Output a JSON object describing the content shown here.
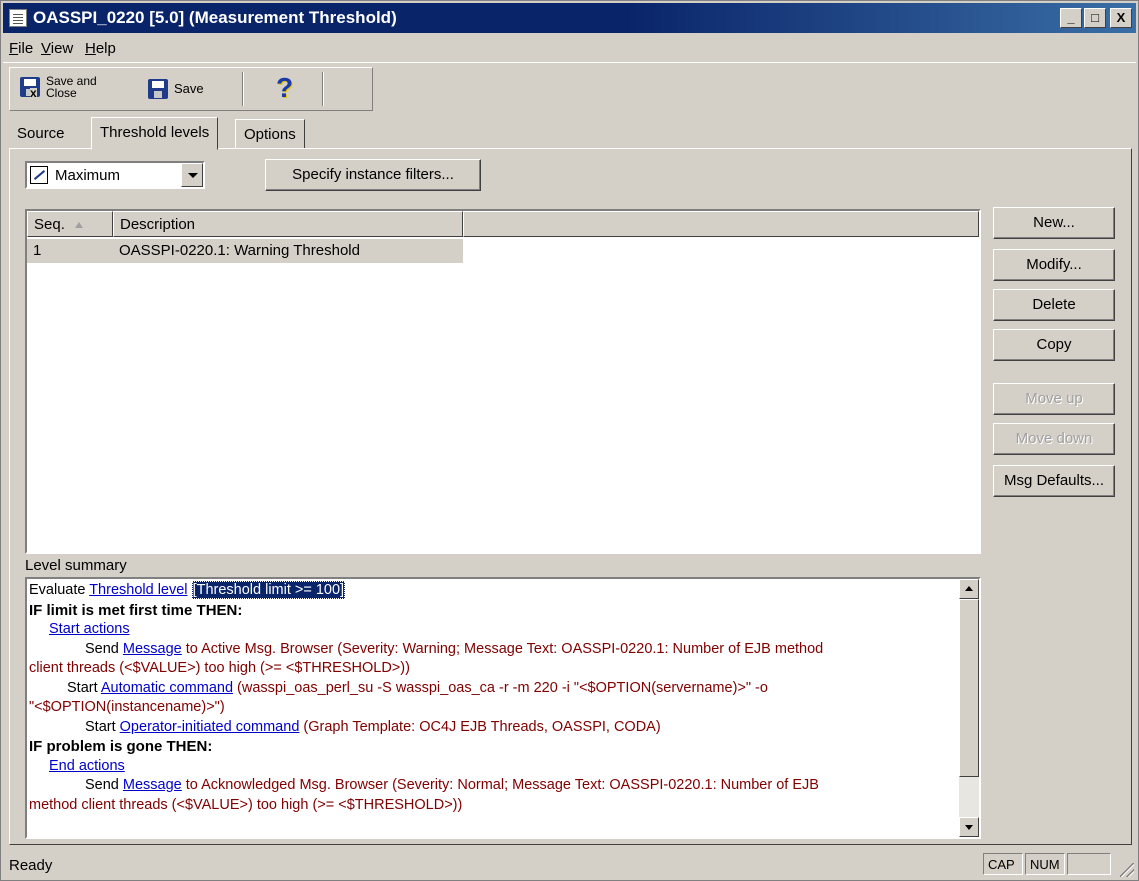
{
  "window": {
    "title": "OASSPI_0220 [5.0] (Measurement Threshold)",
    "minimize": "_",
    "maximize": "□",
    "close": "X"
  },
  "menu": [
    {
      "underline": "F",
      "rest": "ile"
    },
    {
      "underline": "V",
      "rest": "iew"
    },
    {
      "underline": "H",
      "rest": "elp"
    }
  ],
  "toolbar": {
    "save_close_line1": "Save and",
    "save_close_line2": "Close",
    "save": "Save",
    "help_icon": "help-icon"
  },
  "tabs": {
    "source": "Source",
    "threshold_levels": "Threshold levels",
    "options": "Options",
    "active": "threshold_levels"
  },
  "combo": {
    "value": "Maximum"
  },
  "filters_button": "Specify instance filters...",
  "list": {
    "columns": [
      "Seq.",
      "Description"
    ],
    "rows": [
      {
        "seq": "1",
        "description": "OASSPI-0220.1: Warning Threshold"
      }
    ]
  },
  "side_buttons": {
    "new": "New...",
    "modify": "Modify...",
    "delete": "Delete",
    "copy": "Copy",
    "move_up": "Move up",
    "move_down": "Move down",
    "msg_defaults": "Msg Defaults..."
  },
  "summary": {
    "label": "Level summary",
    "evaluate": "Evaluate ",
    "threshold_level_link": "Threshold level",
    "threshold_limit": "[Threshold limit >= 100]",
    "if_met": "IF limit is met first time THEN:",
    "start_actions": "Start actions",
    "send1_prefix": "Send ",
    "message_link": "Message",
    "send1_text_a": " to Active Msg. Browser (Severity: Warning;  Message Text: OASSPI-0220.1: Number of EJB method",
    "send1_text_b": "client threads (<$VALUE>) too high (>= <$THRESHOLD>))",
    "start_prefix": "Start ",
    "auto_cmd_link": "Automatic command",
    "auto_cmd_text_a": " (wasspi_oas_perl_su -S wasspi_oas_ca -r -m 220 -i \"<$OPTION(servername)>\" -o",
    "auto_cmd_text_b": "\"<$OPTION(instancename)>\")",
    "op_cmd_link": "Operator-initiated command",
    "op_cmd_text": " (Graph Template:  OC4J EJB Threads, OASSPI, CODA)",
    "if_gone": "IF problem is gone THEN:",
    "end_actions": "End actions",
    "send2_text_a": " to Acknowledged Msg. Browser (Severity: Normal;  Message Text: OASSPI-0220.1: Number of EJB",
    "send2_text_b": "method client threads (<$VALUE>) too high (>= <$THRESHOLD>))"
  },
  "status": {
    "text": "Ready",
    "cap": "CAP",
    "num": "NUM",
    "empty": ""
  }
}
